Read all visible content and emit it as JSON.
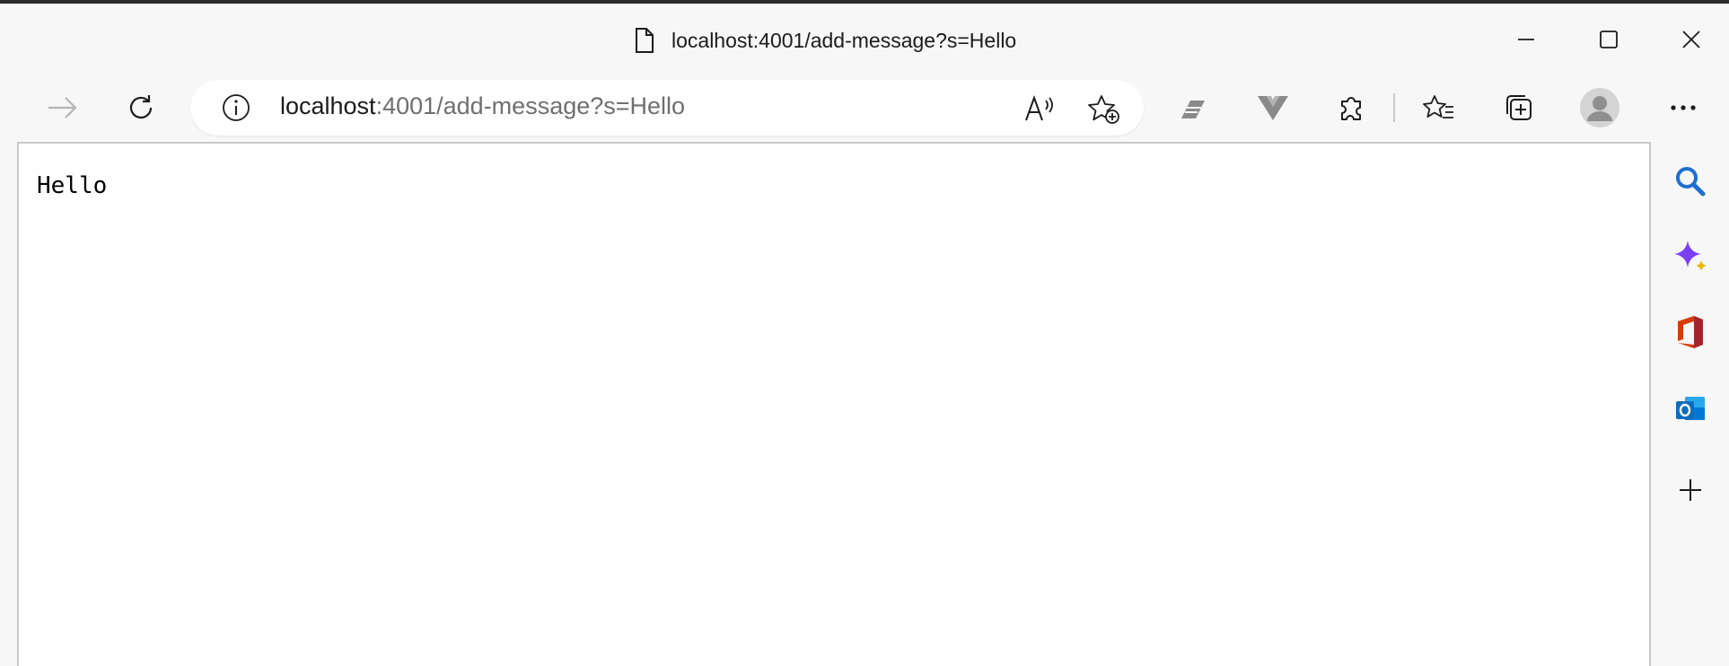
{
  "window": {
    "title": "localhost:4001/add-message?s=Hello"
  },
  "address_bar": {
    "host": "localhost",
    "rest": ":4001/add-message?s=Hello"
  },
  "page": {
    "body_text": "Hello"
  },
  "icons": {
    "title_page": "page-icon",
    "minimize": "minimize-icon",
    "maximize": "maximize-icon",
    "close": "close-icon",
    "forward": "forward-arrow-icon",
    "refresh": "refresh-icon",
    "site_info": "info-icon",
    "read_aloud": "read-aloud-icon",
    "add_favorite": "add-favorite-star-icon",
    "extension_1": "quill-extension-icon",
    "extension_2": "vue-devtools-icon",
    "extensions": "puzzle-icon",
    "favorites": "favorites-icon",
    "collections": "collections-icon",
    "profile": "profile-avatar-icon",
    "more": "more-dots-icon",
    "sidebar_search": "search-icon",
    "sidebar_copilot": "copilot-sparkle-icon",
    "sidebar_office": "office-icon",
    "sidebar_outlook": "outlook-icon",
    "sidebar_add": "plus-icon"
  },
  "colors": {
    "chrome_bg": "#f7f7f7",
    "content_bg": "#ffffff",
    "search_blue": "#1f6fd1",
    "copilot_purple": "#7b3ff2",
    "office_red": "#d83b01",
    "outlook_blue": "#0f6cbd"
  }
}
